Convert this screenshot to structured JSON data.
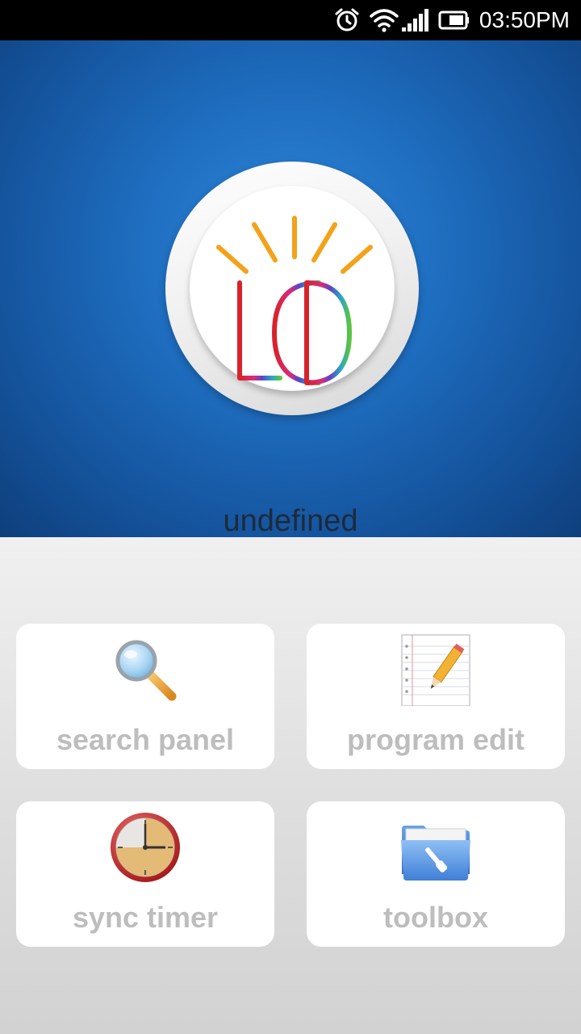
{
  "status_bar": {
    "time": "03:50PM",
    "icons": [
      "alarm-icon",
      "wifi-icon",
      "signal-icon",
      "battery-icon"
    ]
  },
  "hero": {
    "logo": "LED",
    "device_name": "undefined"
  },
  "menu": {
    "items": [
      {
        "label": "search panel",
        "icon": "magnifier-icon"
      },
      {
        "label": "program edit",
        "icon": "notepad-pencil-icon"
      },
      {
        "label": "sync timer",
        "icon": "clock-icon"
      },
      {
        "label": "toolbox",
        "icon": "folder-tool-icon"
      }
    ]
  },
  "colors": {
    "hero_blue": "#1f6fc2",
    "tile_label": "#bdbdbd",
    "tile_bg": "#ffffff"
  }
}
